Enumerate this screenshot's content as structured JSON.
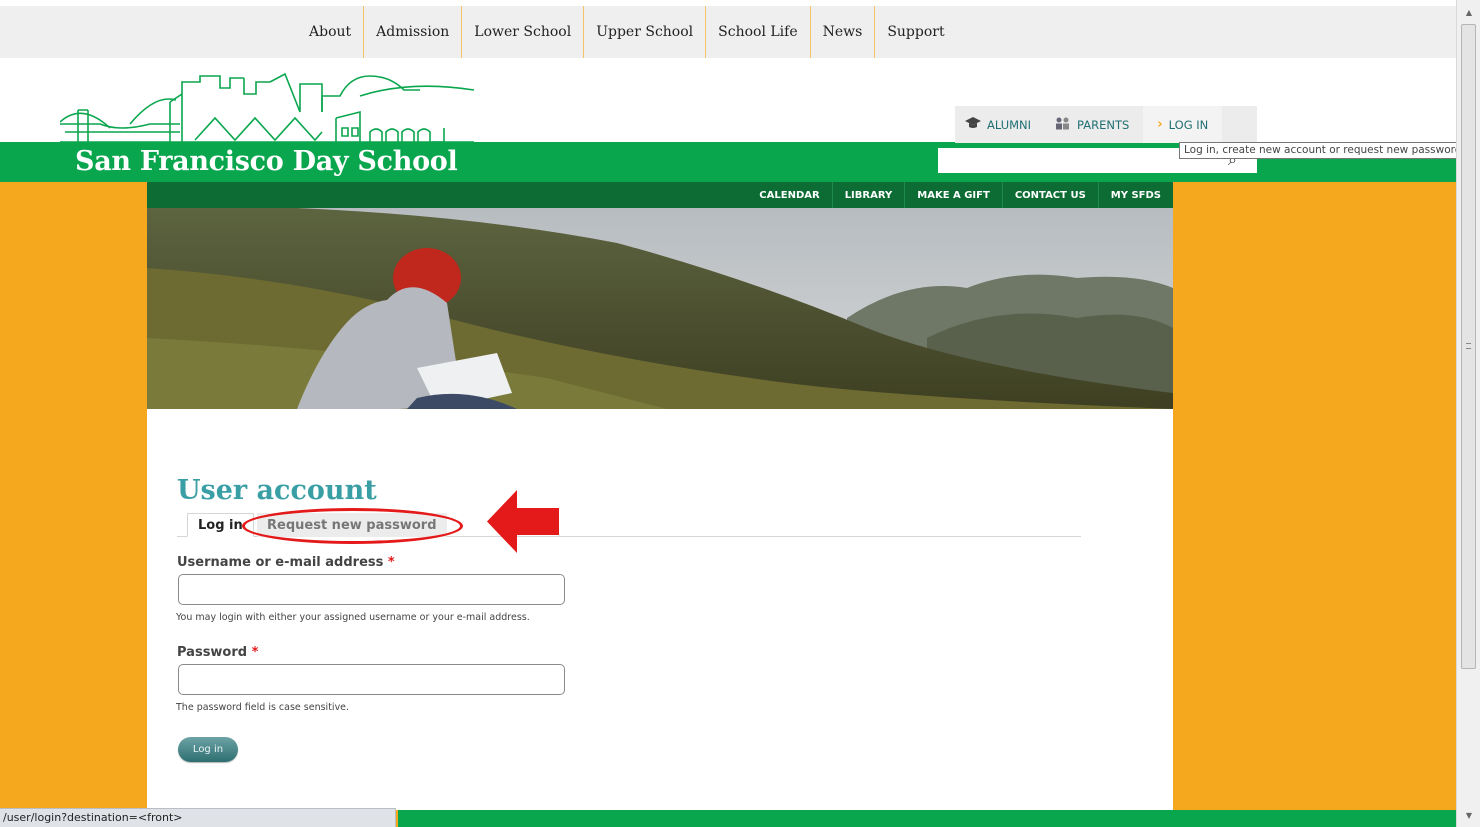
{
  "topnav": {
    "items": [
      "About",
      "Admission",
      "Lower School",
      "Upper School",
      "School Life",
      "News",
      "Support"
    ]
  },
  "header": {
    "school_name": "San Francisco Day School",
    "utility": {
      "alumni": "ALUMNI",
      "parents": "PARENTS",
      "login": "LOG IN"
    },
    "tooltip": "Log in, create new account or request new password."
  },
  "subnav": {
    "items": [
      "CALENDAR",
      "LIBRARY",
      "MAKE A GIFT",
      "CONTACT US",
      "MY SFDS"
    ]
  },
  "main": {
    "title": "User account",
    "tabs": [
      {
        "label": "Log in",
        "active": true
      },
      {
        "label": "Request new password",
        "active": false
      }
    ],
    "form": {
      "username_label": "Username or e-mail address",
      "username_help": "You may login with either your assigned username or your e-mail address.",
      "password_label": "Password",
      "password_help": "The password field is case sensitive.",
      "required_marker": "*",
      "submit_label": "Log in"
    }
  },
  "status_bar": {
    "url": "/user/login?destination=<front>"
  },
  "colors": {
    "orange": "#f5a81d",
    "green": "#0aa64e",
    "dark_green": "#0d6b34",
    "teal_title": "#3a9fa5",
    "annotation_red": "#e41a1a"
  }
}
